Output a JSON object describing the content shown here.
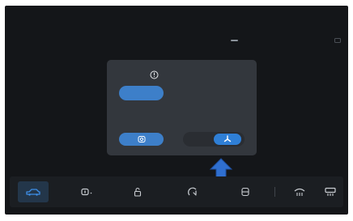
{
  "icons": {
    "top_right": "screen-mirror-icon",
    "dialog_info": "info-icon",
    "camera_button": "camera-icon",
    "toggle_knob": "fan-icon",
    "arrow": "up-arrow-icon"
  },
  "bottom_bar": {
    "tabs": [
      {
        "id": "car",
        "icon": "car-icon",
        "active": true
      },
      {
        "id": "mirror",
        "icon": "side-mirror-icon",
        "active": false
      },
      {
        "id": "lock",
        "icon": "unlock-icon",
        "active": false
      },
      {
        "id": "steering",
        "icon": "steering-wheel-heat-icon",
        "active": false
      },
      {
        "id": "seat",
        "icon": "seat-icon",
        "active": false
      },
      {
        "id": "front_defrost",
        "icon": "front-defrost-icon",
        "active": false
      },
      {
        "id": "rear_defrost",
        "icon": "rear-defrost-icon",
        "active": false
      }
    ]
  },
  "colors": {
    "screen_bg": "#141619",
    "dialog_bg": "#33373d",
    "accent": "#3d7fc9",
    "bar_bg": "#1b1e22",
    "arrow": "#2f6fd0"
  }
}
